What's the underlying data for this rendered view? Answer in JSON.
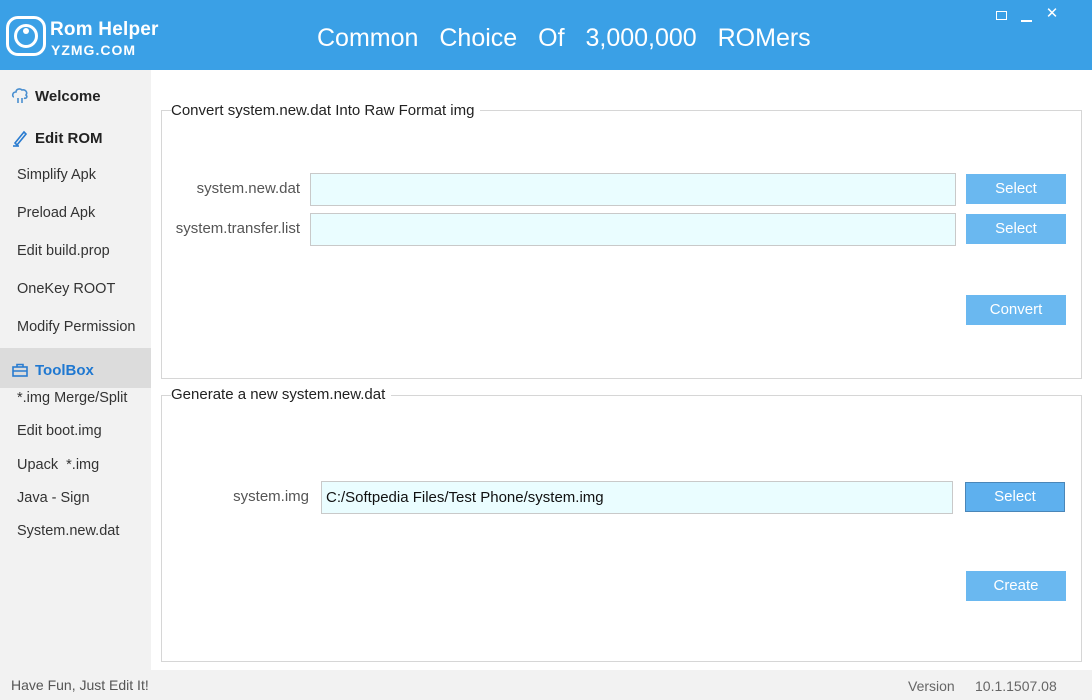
{
  "header": {
    "brand_name": "Rom Helper",
    "brand_sub": "YZMG.COM",
    "slogan": "Common Choice Of 3,000,000 ROMers",
    "accent_color": "#3aa0e6"
  },
  "window_controls": {
    "restore": "restore-icon",
    "minimize": "minimize-icon",
    "close_glyph": "✕"
  },
  "sidebar": {
    "welcome": {
      "label": "Welcome",
      "icon": "welcome-icon"
    },
    "edit_rom": {
      "label": "Edit ROM",
      "icon": "pencil-icon",
      "items": [
        "Simplify Apk",
        "Preload Apk",
        "Edit build.prop",
        "OneKey ROOT",
        "Modify Permission"
      ]
    },
    "toolbox": {
      "label": "ToolBox",
      "icon": "toolbox-icon",
      "items": [
        "*.img Merge/Split",
        "Edit boot.img",
        "Upack  *.img",
        "Java - Sign",
        "System.new.dat"
      ]
    }
  },
  "convert": {
    "title": "Convert system.new.dat Into Raw Format img",
    "dat_label": "system.new.dat",
    "dat_value": "",
    "transfer_label": "system.transfer.list",
    "transfer_value": "",
    "select_label": "Select",
    "convert_label": "Convert"
  },
  "generate": {
    "title": "Generate a new system.new.dat",
    "img_label": "system.img",
    "img_value": "C:/Softpedia Files/Test Phone/system.img",
    "select_label": "Select",
    "create_label": "Create"
  },
  "footer": {
    "tagline": "Have Fun, Just Edit It!",
    "version_label": "Version",
    "version_value": "10.1.1507.08"
  }
}
